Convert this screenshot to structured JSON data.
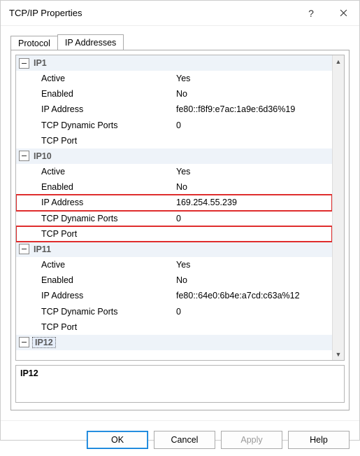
{
  "window": {
    "title": "TCP/IP Properties",
    "help_glyph": "?",
    "close_glyph": "✕"
  },
  "tabs": {
    "protocol": "Protocol",
    "ip_addresses": "IP Addresses"
  },
  "gridLabels": {
    "active": "Active",
    "enabled": "Enabled",
    "ip_address": "IP Address",
    "tcp_dynamic_ports": "TCP Dynamic Ports",
    "tcp_port": "TCP Port"
  },
  "groups": {
    "ip1": {
      "title": "IP1",
      "active": "Yes",
      "enabled": "No",
      "ip_address": "fe80::f8f9:e7ac:1a9e:6d36%19",
      "tcp_dynamic_ports": "0",
      "tcp_port": ""
    },
    "ip10": {
      "title": "IP10",
      "active": "Yes",
      "enabled": "No",
      "ip_address": "169.254.55.239",
      "tcp_dynamic_ports": "0",
      "tcp_port": ""
    },
    "ip11": {
      "title": "IP11",
      "active": "Yes",
      "enabled": "No",
      "ip_address": "fe80::64e0:6b4e:a7cd:c63a%12",
      "tcp_dynamic_ports": "0",
      "tcp_port": ""
    },
    "ip12": {
      "title": "IP12"
    }
  },
  "description": {
    "title": "IP12"
  },
  "buttons": {
    "ok": "OK",
    "cancel": "Cancel",
    "apply": "Apply",
    "help": "Help"
  }
}
